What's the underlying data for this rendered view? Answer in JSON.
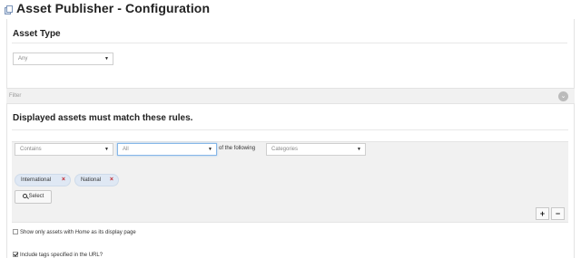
{
  "header": {
    "title": "Asset Publisher - Configuration",
    "icon": "asset-publisher-icon"
  },
  "asset_type": {
    "heading": "Asset Type",
    "select_value": "Any"
  },
  "filter": {
    "bar_label": "Filter",
    "toggle_icon": "chevron-down-circle-icon",
    "rules_heading": "Displayed assets must match these rules.",
    "rule": {
      "operator_value": "Contains",
      "quantifier_value": "All",
      "connector_text": "of the following",
      "field_value": "Categories"
    },
    "tags": [
      {
        "label": "International",
        "remove": "×"
      },
      {
        "label": "National",
        "remove": "×"
      }
    ],
    "select_button_label": "Select",
    "add_rule_label": "+",
    "remove_rule_label": "−"
  },
  "options": {
    "show_only_prefix": "Show only assets with ",
    "show_only_emph": "Home",
    "show_only_suffix": " as its display page",
    "show_only_checked": false,
    "include_tags_label": "Include tags specified in the URL?",
    "include_tags_checked": true
  },
  "colors": {
    "tag_bg": "#dfe8f4",
    "tag_remove": "#c0262c",
    "panel_grey": "#f1f1f1"
  }
}
